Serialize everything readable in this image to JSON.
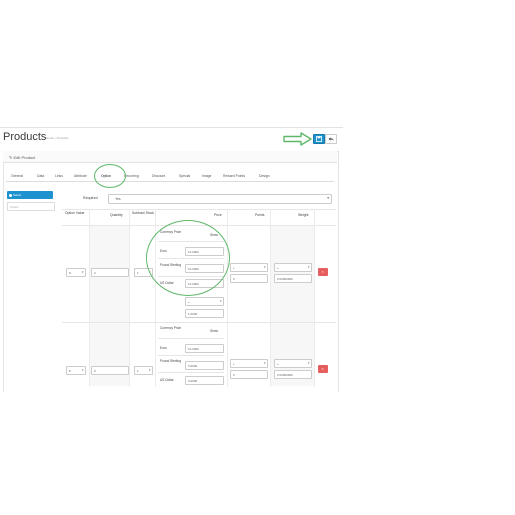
{
  "header": {
    "title": "Products",
    "breadcrumb": "Home › Products"
  },
  "panel": {
    "title": "Edit Product"
  },
  "tabs": [
    "General",
    "Data",
    "Links",
    "Attribute",
    "Option",
    "Recurring",
    "Discount",
    "Special",
    "Image",
    "Reward Points",
    "Design"
  ],
  "active_tab": "Option",
  "option_sidebar": {
    "active_item": "Select",
    "input_placeholder": "Option"
  },
  "required": {
    "label": "Required",
    "value": "Yes"
  },
  "table": {
    "headers": [
      "Option Value",
      "Quantity",
      "Subtract Stock",
      "Price",
      "Points",
      "Weight"
    ],
    "rows": [
      {
        "option_value": "8",
        "quantity": "2",
        "subtract": "1",
        "price_table": {
          "header_currency": "Currency Price",
          "header_sign": "Show",
          "lines": [
            {
              "currency": "Euro",
              "value": "10.0000"
            },
            {
              "currency": "Pound Sterling",
              "value": "10.0000"
            },
            {
              "currency": "US Dollar",
              "value": "10.0000"
            }
          ]
        },
        "price_prefix": "+",
        "price_extra": "1.0000",
        "points_prefix": "+",
        "points": "0",
        "weight_prefix": "+",
        "weight": "0.00000000"
      },
      {
        "option_value": "8",
        "quantity": "0",
        "subtract": "1",
        "price_table": {
          "header_currency": "Currency Price",
          "header_sign": "Show",
          "lines": [
            {
              "currency": "Euro",
              "value": "10.0000"
            },
            {
              "currency": "Pound Sterling",
              "value": "0.0000"
            },
            {
              "currency": "US Dollar",
              "value": "0.0000"
            }
          ]
        },
        "points_prefix": "+",
        "points": "0",
        "weight_prefix": "+",
        "weight": "0.00000000"
      }
    ]
  },
  "colors": {
    "primary": "#1e91cf",
    "danger": "#e65e5e",
    "highlight": "#5fb86a"
  },
  "icons": {
    "save": "save-icon",
    "back": "reply-icon",
    "delete": "minus-circle-icon",
    "arrow": "arrow-right-icon"
  }
}
